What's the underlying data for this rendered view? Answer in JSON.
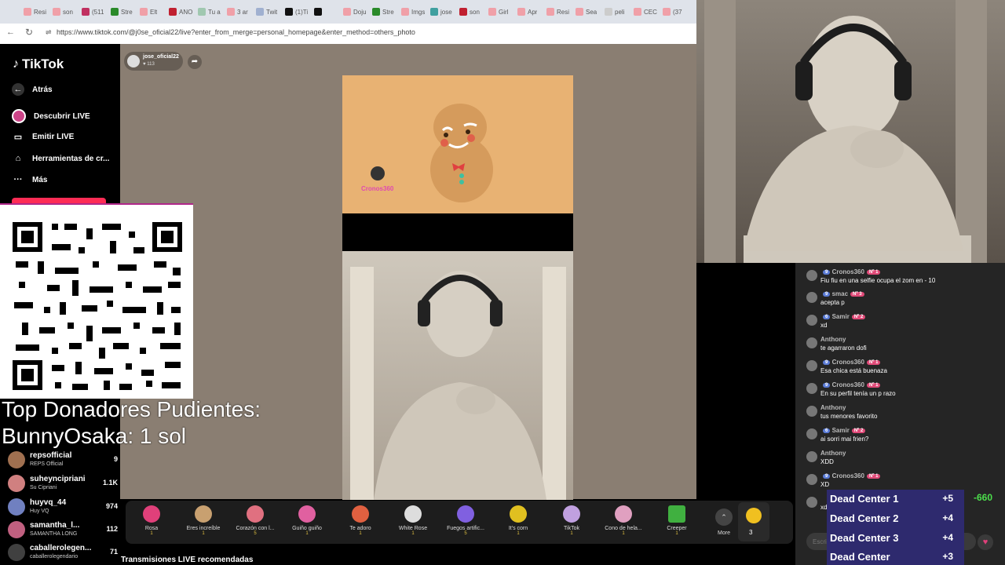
{
  "browser": {
    "tabs": [
      "Resi",
      "son",
      "(511",
      "Stre",
      "Elt",
      "ANO",
      "Tu a",
      "3 ar",
      "Twit",
      "(1)Ti",
      "",
      "Doju",
      "Stre",
      "Imgs",
      "jose",
      "son",
      "Girl",
      "Apr",
      "Resi",
      "Sea",
      "peli",
      "CEC",
      "(37"
    ],
    "url": "https://www.tiktok.com/@j0se_oficial22/live?enter_from_merge=personal_homepage&enter_method=others_photo"
  },
  "sidebar": {
    "logo": "TikTok",
    "items": [
      {
        "label": "Atrás",
        "icon": "arrow-left-icon"
      },
      {
        "label": "Descubrir LIVE",
        "icon": "live-avatar-icon"
      },
      {
        "label": "Emitir LIVE",
        "icon": "camera-icon"
      },
      {
        "label": "Herramientas de cr...",
        "icon": "home-icon"
      },
      {
        "label": "Más",
        "icon": "more-icon"
      }
    ]
  },
  "host": {
    "name": "jose_oficial22",
    "likes": "113"
  },
  "cookie_overlay_text": "Cronos360",
  "leaderboard": [
    {
      "name": "repsofficial",
      "sub": "REPS Official",
      "count": "9"
    },
    {
      "name": "suheyncipriani",
      "sub": "Su Cipriani",
      "count": "1.1K"
    },
    {
      "name": "huyvq_44",
      "sub": "Huy VQ",
      "count": "974"
    },
    {
      "name": "samantha_l...",
      "sub": "SAMANTHA LONG",
      "count": "112"
    },
    {
      "name": "caballerolegen...",
      "sub": "caballerolegendario",
      "count": "71"
    }
  ],
  "donors": {
    "title": "Top Donadores Pudientes:",
    "entry": "BunnyOsaka: 1 sol"
  },
  "recommended": "Transmisiones LIVE recomendadas",
  "gifts": [
    {
      "name": "Rosa",
      "price": "1",
      "color": "#e0407a"
    },
    {
      "name": "Eres increíble",
      "price": "1",
      "color": "#c8a070"
    },
    {
      "name": "Corazón con l...",
      "price": "5",
      "color": "#e07080"
    },
    {
      "name": "Guiño guiño",
      "price": "1",
      "color": "#e060a0"
    },
    {
      "name": "Te adoro",
      "price": "1",
      "color": "#e06040"
    },
    {
      "name": "White Rose",
      "price": "1",
      "color": "#dddddd"
    },
    {
      "name": "Fuegos artific...",
      "price": "5",
      "color": "#8060e0"
    },
    {
      "name": "It's corn",
      "price": "1",
      "color": "#e0c020"
    },
    {
      "name": "TikTok",
      "price": "1",
      "color": "#c0a0e0"
    },
    {
      "name": "Cono de hela...",
      "price": "1",
      "color": "#e0a0c0"
    },
    {
      "name": "Creeper",
      "price": "1",
      "color": "#40b040"
    }
  ],
  "gift_more": "More",
  "coin_balance": "3",
  "chat": [
    {
      "name": "Cronos360",
      "badges": [
        "9",
        "Nº 1"
      ],
      "text": "Fiu fiu en una selfie ocupa el zom en - 10"
    },
    {
      "name": "smac",
      "badges": [
        "9",
        "Nº 3"
      ],
      "text": "acepta p"
    },
    {
      "name": "Samir",
      "badges": [
        "6",
        "Nº 2"
      ],
      "text": "xd"
    },
    {
      "name": "Anthony",
      "badges": [],
      "text": "te agarraron dofi"
    },
    {
      "name": "Cronos360",
      "badges": [
        "9",
        "Nº 1"
      ],
      "text": "Esa chica está buenaza"
    },
    {
      "name": "Cronos360",
      "badges": [
        "9",
        "Nº 1"
      ],
      "text": "En su perfil tenía un p razo"
    },
    {
      "name": "Anthony",
      "badges": [],
      "text": "tus menores favorito"
    },
    {
      "name": "Samir",
      "badges": [
        "6",
        "Nº 2"
      ],
      "text": "ai sorri mai frien?"
    },
    {
      "name": "Anthony",
      "badges": [],
      "text": "XDD"
    },
    {
      "name": "Cronos360",
      "badges": [
        "9",
        "Nº 1"
      ],
      "text": "XD"
    },
    {
      "name": "",
      "badges": [],
      "text": "xd"
    }
  ],
  "chat_input_placeholder": "Escribe...",
  "dead_center": [
    {
      "label": "Dead Center 1",
      "value": "+5"
    },
    {
      "label": "Dead Center 2",
      "value": "+4"
    },
    {
      "label": "Dead Center 3",
      "value": "+4"
    },
    {
      "label": "Dead Center",
      "value": "+3"
    }
  ],
  "score": "-660"
}
